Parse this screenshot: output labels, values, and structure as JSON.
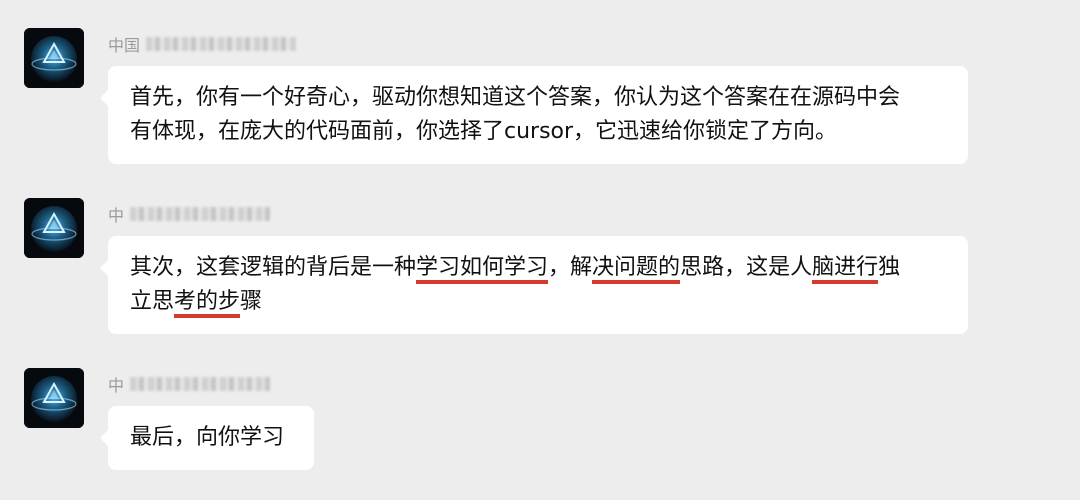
{
  "messages": [
    {
      "sender_visible": "中国",
      "lines": [
        "首先，你有一个好奇心，驱动你想知道这个答案，你认为这个答案在在源码中会",
        "有体现，在庞大的代码面前，你选择了cursor，它迅速给你锁定了方向。"
      ]
    },
    {
      "sender_visible": "中",
      "line1": {
        "p1": "其次，这套逻辑的背后是一种",
        "u1": "学习如何学习",
        "p2": "，解",
        "u2": "决问题的",
        "p3": "思路，这是人",
        "u3": "脑进行",
        "p4": "独"
      },
      "line2": {
        "p1": "立思",
        "u1": "考的步",
        "p2": "骤"
      }
    },
    {
      "sender_visible": "中",
      "lines": [
        "最后，向你学习"
      ]
    }
  ],
  "colors": {
    "background": "#ededed",
    "bubble": "#ffffff",
    "underline": "#d43a2f",
    "sender_text": "#9a9a9a"
  },
  "icons": [
    "avatar-crystal-icon"
  ]
}
